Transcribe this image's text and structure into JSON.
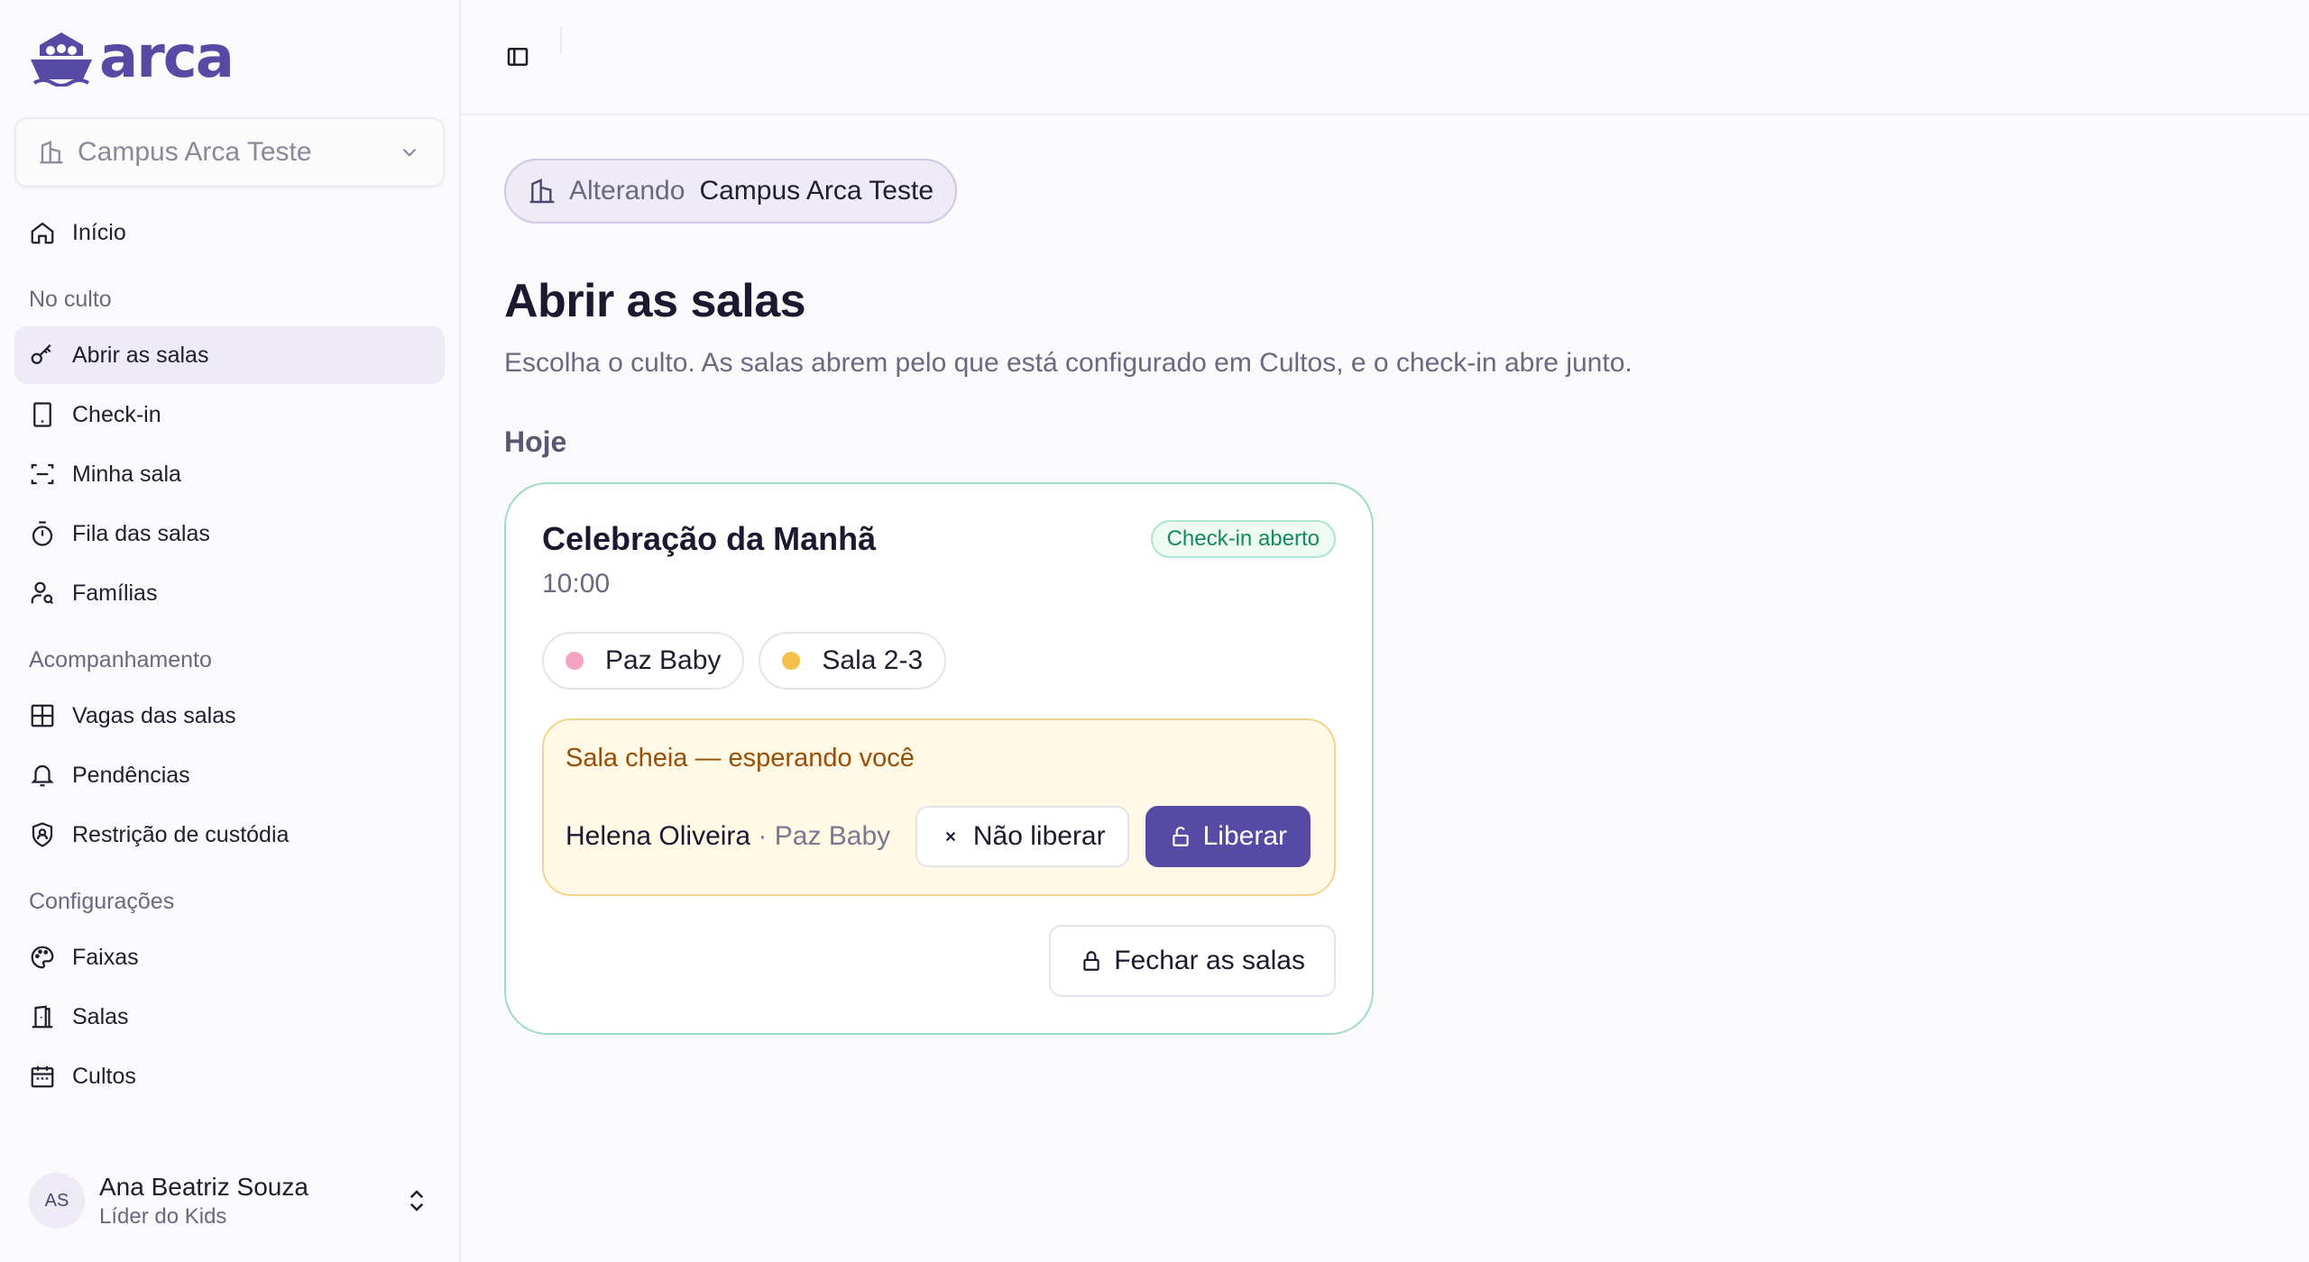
{
  "brand": {
    "name": "arca",
    "color": "#574aa5"
  },
  "sidebar": {
    "campus_select": {
      "value": "Campus Arca Teste"
    },
    "home": {
      "label": "Início",
      "icon": "home-icon"
    },
    "sections": [
      {
        "label": "No culto",
        "items": [
          {
            "label": "Abrir as salas",
            "icon": "key-icon",
            "active": true
          },
          {
            "label": "Check-in",
            "icon": "tablet-icon"
          },
          {
            "label": "Minha sala",
            "icon": "scan-icon"
          },
          {
            "label": "Fila das salas",
            "icon": "timer-icon"
          },
          {
            "label": "Famílias",
            "icon": "user-search-icon"
          }
        ]
      },
      {
        "label": "Acompanhamento",
        "items": [
          {
            "label": "Vagas das salas",
            "icon": "grid-icon"
          },
          {
            "label": "Pendências",
            "icon": "bell-icon"
          },
          {
            "label": "Restrição de custódia",
            "icon": "shield-user-icon"
          }
        ]
      },
      {
        "label": "Configurações",
        "items": [
          {
            "label": "Faixas",
            "icon": "palette-icon"
          },
          {
            "label": "Salas",
            "icon": "door-icon"
          },
          {
            "label": "Cultos",
            "icon": "calendar-icon"
          }
        ]
      }
    ],
    "user": {
      "initials": "AS",
      "name": "Ana Beatriz Souza",
      "role": "Líder do Kids"
    }
  },
  "main": {
    "campus_chip": {
      "label": "Alterando",
      "value": "Campus Arca Teste"
    },
    "title": "Abrir as salas",
    "subtitle": "Escolha o culto. As salas abrem pelo que está configurado em Cultos, e o check-in abre junto.",
    "day_label": "Hoje",
    "service": {
      "name": "Celebração da Manhã",
      "time": "10:00",
      "status": "Check-in aberto",
      "rooms": [
        {
          "name": "Paz Baby",
          "color": "#f4a3c3"
        },
        {
          "name": "Sala 2-3",
          "color": "#f5c04a"
        }
      ],
      "waiting": {
        "title": "Sala cheia — esperando você",
        "child_name": "Helena Oliveira",
        "child_room": " · Paz Baby",
        "deny_label": "Não liberar",
        "allow_label": "Liberar"
      },
      "close_label": "Fechar as salas"
    }
  },
  "colors": {
    "accent": "#574aa5",
    "success": "#138a5a",
    "warning": "#9a4d06"
  }
}
